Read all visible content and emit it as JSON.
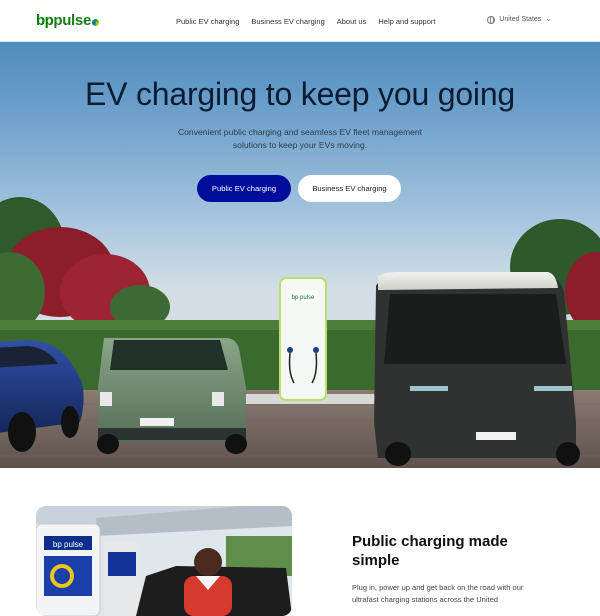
{
  "header": {
    "logo": {
      "bp": "bp",
      "pulse": "pulse"
    },
    "nav": [
      {
        "label": "Public EV charging"
      },
      {
        "label": "Business EV charging"
      },
      {
        "label": "About us"
      },
      {
        "label": "Help and support"
      }
    ],
    "region": {
      "label": "United States",
      "icon": "globe-icon"
    }
  },
  "hero": {
    "title": "EV charging to keep you going",
    "subtitle": "Convenient public charging and seamless EV fleet management solutions to keep your EVs moving.",
    "primary_button": "Public EV charging",
    "secondary_button": "Business EV charging",
    "charger_logo": "bp pulse"
  },
  "section": {
    "title": "Public charging made simple",
    "body": "Plug in, power up and get back on the road with our ultrafast charging stations across the United"
  },
  "colors": {
    "brand_green": "#007f00",
    "primary_button": "#000c9a",
    "sky": "#79a7cf"
  }
}
